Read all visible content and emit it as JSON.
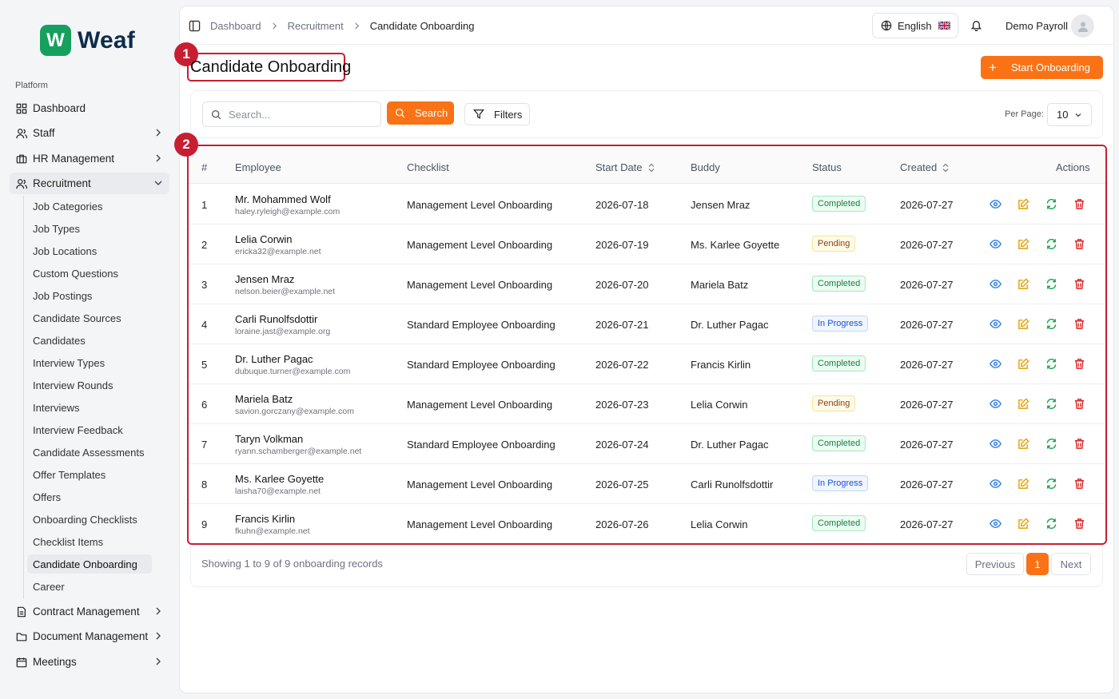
{
  "app": {
    "logo_letter": "W",
    "name": "Weaf"
  },
  "sidebar": {
    "section": "Platform",
    "items": [
      {
        "label": "Dashboard",
        "icon": "grid-icon"
      },
      {
        "label": "Staff",
        "icon": "users-icon"
      },
      {
        "label": "HR Management",
        "icon": "briefcase-icon"
      },
      {
        "label": "Recruitment",
        "icon": "user-search-icon"
      },
      {
        "label": "Contract Management",
        "icon": "file-icon"
      },
      {
        "label": "Document Management",
        "icon": "folder-icon"
      },
      {
        "label": "Meetings",
        "icon": "calendar-icon"
      }
    ],
    "recruitment_sub": [
      "Job Categories",
      "Job Types",
      "Job Locations",
      "Custom Questions",
      "Job Postings",
      "Candidate Sources",
      "Candidates",
      "Interview Types",
      "Interview Rounds",
      "Interviews",
      "Interview Feedback",
      "Candidate Assessments",
      "Offer Templates",
      "Offers",
      "Onboarding Checklists",
      "Checklist Items",
      "Candidate Onboarding",
      "Career"
    ]
  },
  "header": {
    "breadcrumbs": [
      "Dashboard",
      "Recruitment",
      "Candidate Onboarding"
    ],
    "language": "English",
    "user": "Demo Payroll"
  },
  "page": {
    "title": "Candidate Onboarding",
    "start_button": "Start Onboarding",
    "markers": [
      "1",
      "2"
    ]
  },
  "toolbar": {
    "search_placeholder": "Search...",
    "search_button": "Search",
    "filters_button": "Filters",
    "per_page_label": "Per Page:",
    "per_page_value": "10"
  },
  "table": {
    "columns": [
      "#",
      "Employee",
      "Checklist",
      "Start Date",
      "Buddy",
      "Status",
      "Created",
      "Actions"
    ],
    "rows": [
      {
        "n": "1",
        "name": "Mr. Mohammed Wolf",
        "email": "haley.ryleigh@example.com",
        "checklist": "Management Level Onboarding",
        "start": "2026-07-18",
        "buddy": "Jensen Mraz",
        "status": "Completed",
        "created": "2026-07-27"
      },
      {
        "n": "2",
        "name": "Lelia Corwin",
        "email": "ericka32@example.net",
        "checklist": "Management Level Onboarding",
        "start": "2026-07-19",
        "buddy": "Ms. Karlee Goyette",
        "status": "Pending",
        "created": "2026-07-27"
      },
      {
        "n": "3",
        "name": "Jensen Mraz",
        "email": "nelson.beier@example.net",
        "checklist": "Management Level Onboarding",
        "start": "2026-07-20",
        "buddy": "Mariela Batz",
        "status": "Completed",
        "created": "2026-07-27"
      },
      {
        "n": "4",
        "name": "Carli Runolfsdottir",
        "email": "loraine.jast@example.org",
        "checklist": "Standard Employee Onboarding",
        "start": "2026-07-21",
        "buddy": "Dr. Luther Pagac",
        "status": "In Progress",
        "created": "2026-07-27"
      },
      {
        "n": "5",
        "name": "Dr. Luther Pagac",
        "email": "dubuque.turner@example.com",
        "checklist": "Standard Employee Onboarding",
        "start": "2026-07-22",
        "buddy": "Francis Kirlin",
        "status": "Completed",
        "created": "2026-07-27"
      },
      {
        "n": "6",
        "name": "Mariela Batz",
        "email": "savion.gorczany@example.com",
        "checklist": "Management Level Onboarding",
        "start": "2026-07-23",
        "buddy": "Lelia Corwin",
        "status": "Pending",
        "created": "2026-07-27"
      },
      {
        "n": "7",
        "name": "Taryn Volkman",
        "email": "ryann.schamberger@example.net",
        "checklist": "Standard Employee Onboarding",
        "start": "2026-07-24",
        "buddy": "Dr. Luther Pagac",
        "status": "Completed",
        "created": "2026-07-27"
      },
      {
        "n": "8",
        "name": "Ms. Karlee Goyette",
        "email": "laisha70@example.net",
        "checklist": "Management Level Onboarding",
        "start": "2026-07-25",
        "buddy": "Carli Runolfsdottir",
        "status": "In Progress",
        "created": "2026-07-27"
      },
      {
        "n": "9",
        "name": "Francis Kirlin",
        "email": "fkuhn@example.net",
        "checklist": "Management Level Onboarding",
        "start": "2026-07-26",
        "buddy": "Lelia Corwin",
        "status": "Completed",
        "created": "2026-07-27"
      }
    ]
  },
  "footer": {
    "summary": "Showing 1 to 9 of 9 onboarding records",
    "previous": "Previous",
    "page": "1",
    "next": "Next"
  },
  "colors": {
    "accent": "#f97316",
    "brand": "#16a05d",
    "highlight": "#c81e32"
  }
}
